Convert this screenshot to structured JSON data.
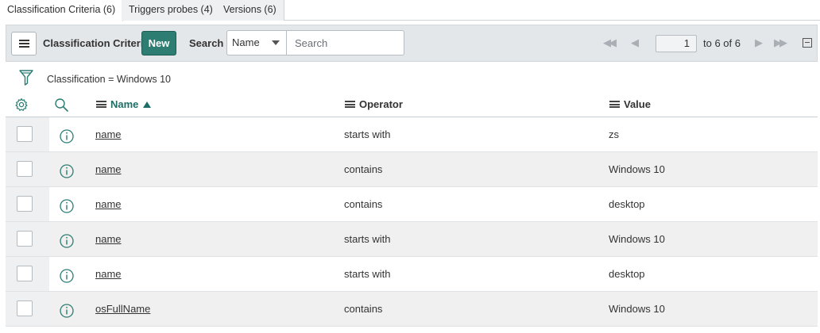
{
  "tabs": [
    {
      "label": "Classification Criteria (6)",
      "active": true
    },
    {
      "label": "Triggers probes (4)",
      "active": false
    },
    {
      "label": "Versions (6)",
      "active": false
    }
  ],
  "toolbar": {
    "list_title": "Classification Criteria",
    "new_label": "New",
    "search_label": "Search",
    "search_field": "Name",
    "search_placeholder": "Search",
    "page_number": "1",
    "page_range": "to 6 of 6"
  },
  "filter": {
    "breadcrumb": "Classification = Windows 10"
  },
  "columns": [
    {
      "label": "Name",
      "sorted": "ascending"
    },
    {
      "label": "Operator"
    },
    {
      "label": "Value"
    }
  ],
  "rows": [
    {
      "name": "name",
      "operator": "starts with",
      "value": "zs"
    },
    {
      "name": "name",
      "operator": "contains",
      "value": "Windows 10"
    },
    {
      "name": "name",
      "operator": "contains",
      "value": "desktop"
    },
    {
      "name": "name",
      "operator": "starts with",
      "value": "Windows 10"
    },
    {
      "name": "name",
      "operator": "starts with",
      "value": "desktop"
    },
    {
      "name": "osFullName",
      "operator": "contains",
      "value": "Windows 10"
    }
  ],
  "colors": {
    "accent": "#2d7d73",
    "toolbar_bg": "#e4e7ea",
    "row_alt_bg": "#f0f0f0"
  }
}
